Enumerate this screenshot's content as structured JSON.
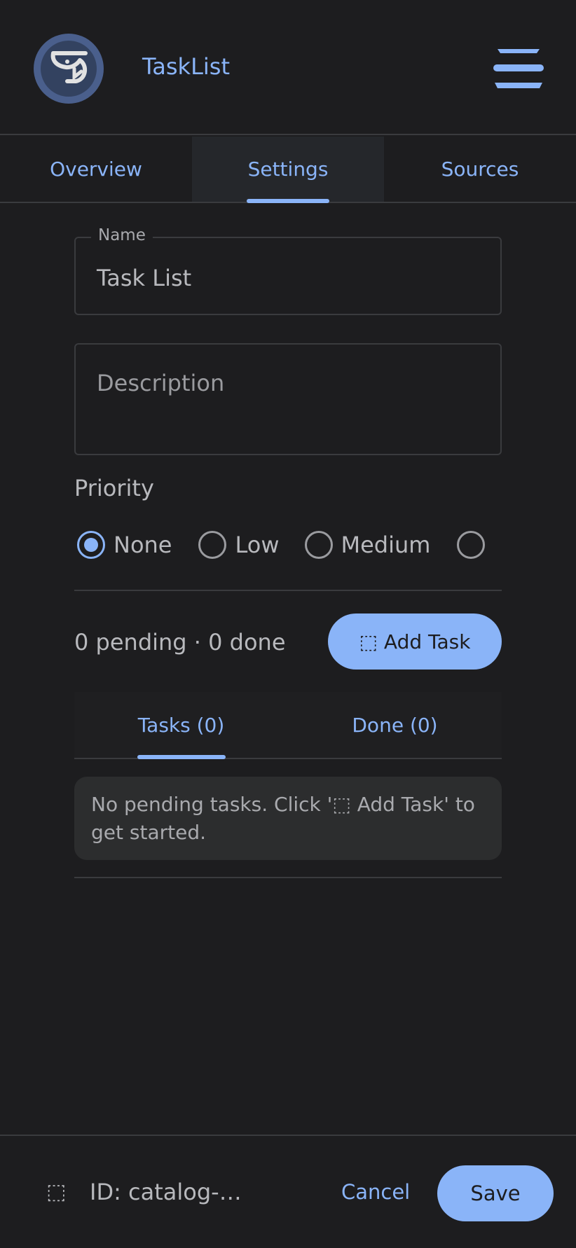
{
  "header": {
    "title": "TaskList",
    "logo_icon": "sink-faucet-icon",
    "menu_icon": "hamburger-menu-icon"
  },
  "tabs": [
    {
      "label": "Overview",
      "active": false
    },
    {
      "label": "Settings",
      "active": true
    },
    {
      "label": "Sources",
      "active": false
    }
  ],
  "form": {
    "name_label": "Name",
    "name_value": "Task List",
    "description_placeholder": "Description",
    "priority_label": "Priority",
    "priority_options": [
      {
        "label": "None",
        "checked": true
      },
      {
        "label": "Low",
        "checked": false
      },
      {
        "label": "Medium",
        "checked": false
      },
      {
        "label": "",
        "checked": false
      }
    ]
  },
  "tasks": {
    "counts": "0 pending · 0 done",
    "add_button": "⬚ Add Task",
    "subtabs": [
      {
        "label": "Tasks (0)",
        "active": true
      },
      {
        "label": "Done (0)",
        "active": false
      }
    ],
    "empty_message": "No pending tasks. Click '⬚ Add Task' to get started."
  },
  "footer": {
    "icon": "⬚",
    "id_text": "ID: catalog-…",
    "cancel_label": "Cancel",
    "save_label": "Save"
  },
  "colors": {
    "accent": "#8ab4f8",
    "background": "#1d1d1f",
    "text": "#b8b9bd",
    "border": "#3a3b3e"
  }
}
